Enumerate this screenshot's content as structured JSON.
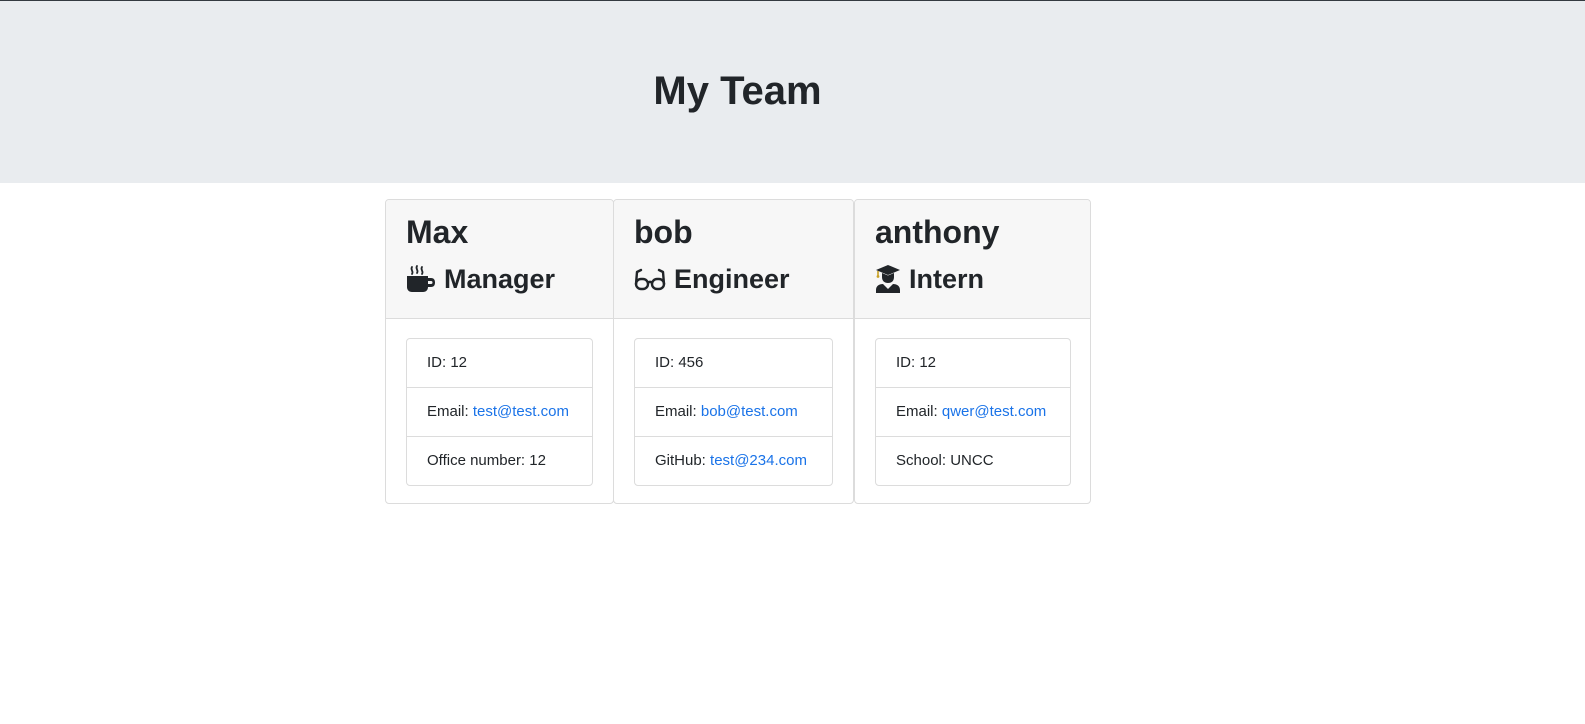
{
  "page": {
    "title": "My Team"
  },
  "team": [
    {
      "name": "Max",
      "role": "Manager",
      "icon": "coffee-mug-icon",
      "id_label": "ID:",
      "id": "12",
      "email_label": "Email:",
      "email": "test@test.com",
      "extra_label": "Office number:",
      "extra": "12"
    },
    {
      "name": "bob",
      "role": "Engineer",
      "icon": "glasses-icon",
      "id_label": "ID:",
      "id": "456",
      "email_label": "Email:",
      "email": "bob@test.com",
      "extra_label": "GitHub:",
      "extra": "test@234.com"
    },
    {
      "name": "anthony",
      "role": "Intern",
      "icon": "graduate-icon",
      "id_label": "ID:",
      "id": "12",
      "email_label": "Email:",
      "email": "qwer@test.com",
      "extra_label": "School:",
      "extra": "UNCC"
    }
  ],
  "colors": {
    "header_background": "#e9ecef",
    "card_header_background": "#f7f7f7",
    "link": "#1a73e8",
    "text": "#212529"
  }
}
